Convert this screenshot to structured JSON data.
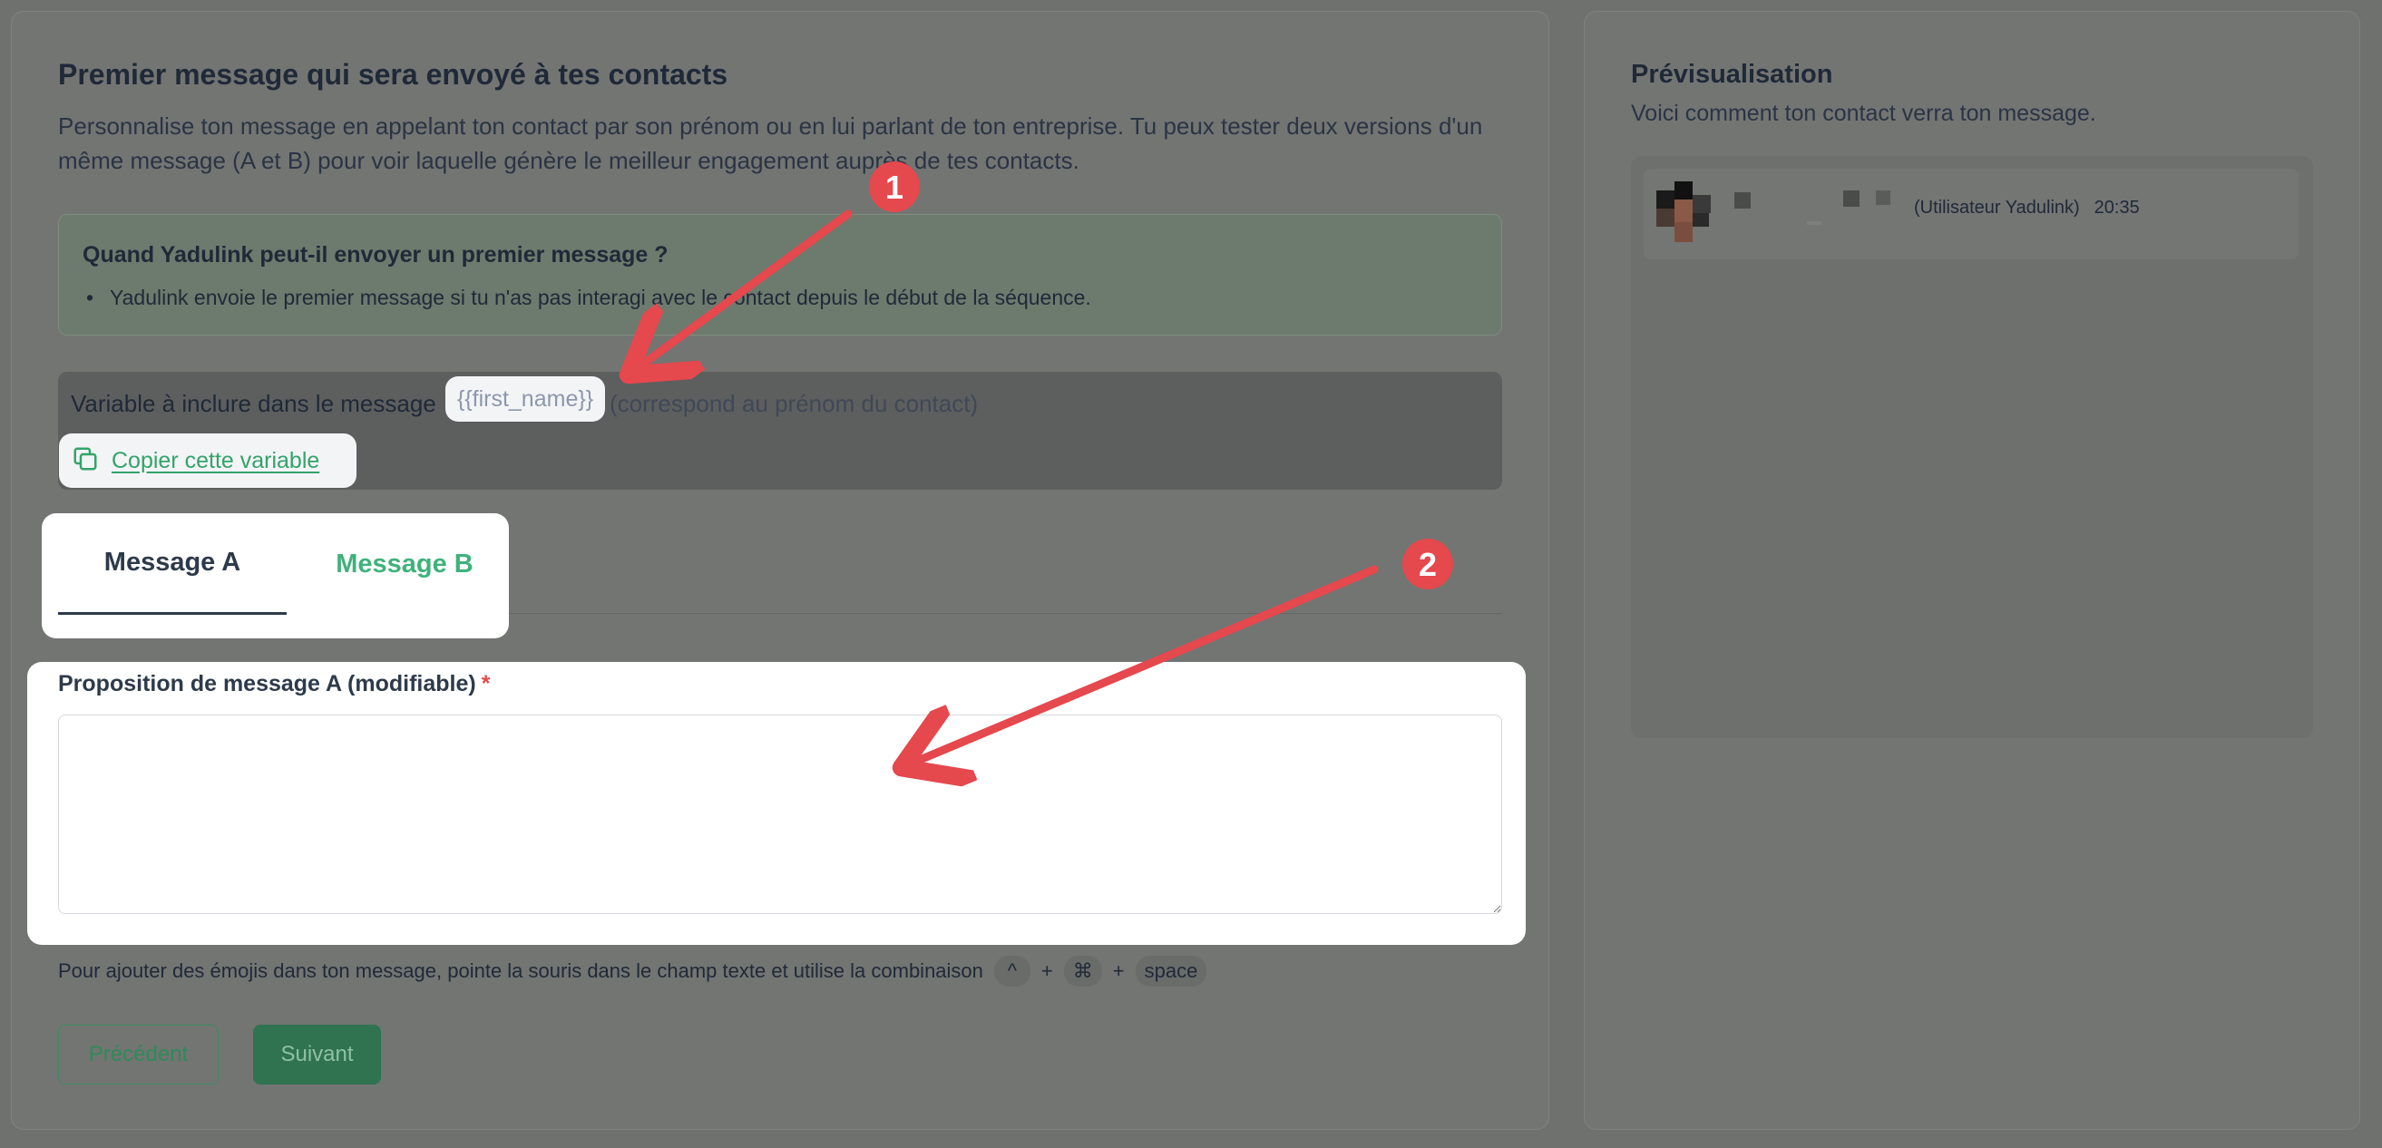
{
  "main": {
    "title": "Premier message qui sera envoyé à tes contacts",
    "description": "Personnalise ton message en appelant ton contact par son prénom ou en lui parlant de ton entreprise. Tu peux tester deux versions d'un même message (A et B) pour voir laquelle génère le meilleur engagement auprès de tes contacts."
  },
  "info": {
    "title": "Quand Yadulink peut-il envoyer un premier message ?",
    "bullet": "Yadulink envoie le premier message si tu n'as pas interagi avec le contact depuis le début de la séquence."
  },
  "variable": {
    "label": "Variable à inclure dans le message",
    "chip": "{{first_name}}",
    "hint": "(correspond au prénom du contact)",
    "copy_label": "Copier cette variable"
  },
  "tabs": [
    {
      "label": "Message A",
      "active": true
    },
    {
      "label": "Message B",
      "active": false
    }
  ],
  "form": {
    "label": "Proposition de message A (modifiable)",
    "required_mark": "*",
    "value": ""
  },
  "emoji_hint": {
    "text": "Pour ajouter des émojis dans ton message, pointe la souris dans le champ texte et utilise la combinaison",
    "keys": [
      "^",
      "⌘",
      "space"
    ],
    "plus": "+"
  },
  "buttons": {
    "previous": "Précédent",
    "next": "Suivant"
  },
  "preview": {
    "title": "Prévisualisation",
    "description": "Voici comment ton contact verra ton message.",
    "sender": "(Utilisateur Yadulink)",
    "time": "20:35"
  },
  "annotations": {
    "badge_1": "1",
    "badge_2": "2",
    "color": "#e5484d"
  },
  "colors": {
    "accent_green": "#3fb27a",
    "dark_green": "#2f7350",
    "annotation_red": "#e5484d"
  }
}
